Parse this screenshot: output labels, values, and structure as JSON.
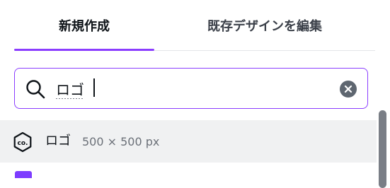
{
  "tabs": {
    "new_label": "新規作成",
    "edit_label": "既存デザインを編集",
    "active": "new"
  },
  "search": {
    "value": "ロゴ",
    "clear_icon": "close-circle-icon",
    "search_icon": "search-icon"
  },
  "results": [
    {
      "icon": "co-badge-icon",
      "name": "ロゴ",
      "size": "500 × 500 px"
    }
  ],
  "colors": {
    "accent": "#8b3dff",
    "text": "#0e1318",
    "muted": "#6b7078",
    "row_highlight": "#f0f1f2"
  }
}
